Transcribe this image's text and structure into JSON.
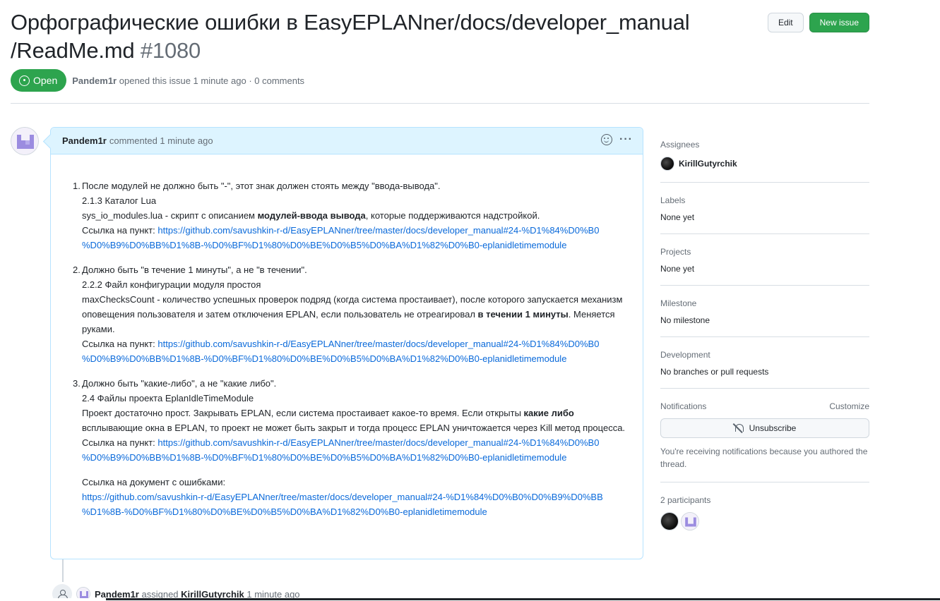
{
  "issue": {
    "title": "Орфографические ошибки в EasyEPLANner/docs/developer_manual /ReadMe.md",
    "number": "#1080",
    "state": "Open",
    "author": "Pandem1r",
    "opened_text": "opened this issue 1 minute ago · 0 comments"
  },
  "header_actions": {
    "edit_label": "Edit",
    "new_issue_label": "New issue"
  },
  "comment": {
    "author": "Pandem1r",
    "when": "commented 1 minute ago",
    "items": [
      {
        "num": "1.",
        "title": "После модулей не должно быть \"-\", этот знак должен стоять между \"ввода-вывода\".",
        "section": "2.1.3 Каталог Lua",
        "text_before": "sys_io_modules.lua - скрипт с описанием ",
        "text_bold": "модулей-ввода вывода",
        "text_after": ", которые поддерживаются надстройкой.",
        "link_label": "Ссылка на пункт: ",
        "link_line1": "https://github.com/savushkin-r-d/EasyEPLANner/tree/master/docs/developer_manual#24-%D1%84%D0%B0",
        "link_line2": "%D0%B9%D0%BB%D1%8B-%D0%BF%D1%80%D0%BE%D0%B5%D0%BA%D1%82%D0%B0-eplanidletimemodule"
      },
      {
        "num": "2.",
        "title": "Должно быть \"в течение 1 минуты\", а не \"в течении\".",
        "section": "2.2.2 Файл конфигурации модуля простоя",
        "text_before": "maxChecksCount - количество успешных проверок подряд (когда система простаивает), после которого запускается механизм оповещения пользователя и затем отключения EPLAN, если пользователь не отреагировал ",
        "text_bold": "в течении 1 минуты",
        "text_after": ". Меняется руками.",
        "link_label": "Ссылка на пункт: ",
        "link_line1": "https://github.com/savushkin-r-d/EasyEPLANner/tree/master/docs/developer_manual#24-%D1%84%D0%B0",
        "link_line2": "%D0%B9%D0%BB%D1%8B-%D0%BF%D1%80%D0%BE%D0%B5%D0%BA%D1%82%D0%B0-eplanidletimemodule"
      },
      {
        "num": "3.",
        "title": "Должно быть \"какие-либо\", а не \"какие либо\".",
        "section": "2.4 Файлы проекта EplanIdleTimeModule",
        "text_before": "Проект достаточно прост. Закрывать EPLAN, если система простаивает какое-то время. Если открыты ",
        "text_bold": "какие либо",
        "text_after": " всплывающие окна в EPLAN, то проект не может быть закрыт и тогда процесс EPLAN уничтожается через Kill метод процесса.",
        "link_label": "Ссылка на пункт: ",
        "link_line1": "https://github.com/savushkin-r-d/EasyEPLANner/tree/master/docs/developer_manual#24-%D1%84%D0%B0",
        "link_line2": "%D0%B9%D0%BB%D1%8B-%D0%BF%D1%80%D0%BE%D0%B5%D0%BA%D1%82%D0%B0-eplanidletimemodule"
      }
    ],
    "doc_label": "Ссылка на документ с ошибками:",
    "doc_link_line1": "https://github.com/savushkin-r-d/EasyEPLANner/tree/master/docs/developer_manual#24-%D1%84%D0%B0%D0%B9%D0%BB",
    "doc_link_line2": "%D1%8B-%D0%BF%D1%80%D0%BE%D0%B5%D0%BA%D1%82%D0%B0-eplanidletimemodule"
  },
  "event": {
    "actor": "Pandem1r",
    "action": "assigned",
    "target": "KirillGutyrchik",
    "when": "1 minute ago"
  },
  "sidebar": {
    "assignees_label": "Assignees",
    "assignee": "KirillGutyrchik",
    "labels_label": "Labels",
    "labels_value": "None yet",
    "projects_label": "Projects",
    "projects_value": "None yet",
    "milestone_label": "Milestone",
    "milestone_value": "No milestone",
    "development_label": "Development",
    "development_value": "No branches or pull requests",
    "notifications_label": "Notifications",
    "customize_label": "Customize",
    "unsubscribe_label": "Unsubscribe",
    "notifications_note": "You're receiving notifications because you authored the thread.",
    "participants_label": "2 participants"
  },
  "colors": {
    "accent_green": "#2da44e",
    "link_blue": "#0969da",
    "comment_header_bg": "#ddf4ff"
  }
}
